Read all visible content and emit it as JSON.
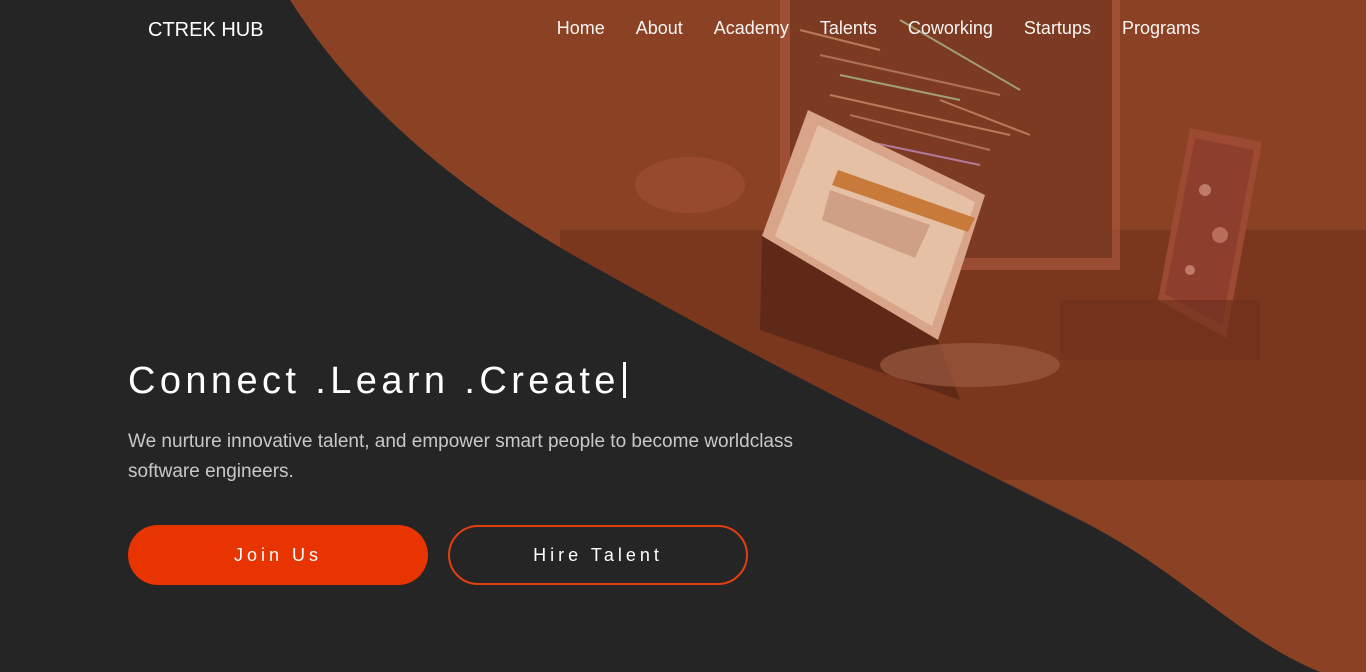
{
  "brand": {
    "name": "CTREK HUB"
  },
  "nav": {
    "items": [
      {
        "label": "Home"
      },
      {
        "label": "About"
      },
      {
        "label": "Academy"
      },
      {
        "label": "Talents"
      },
      {
        "label": "Coworking"
      },
      {
        "label": "Startups"
      },
      {
        "label": "Programs"
      }
    ]
  },
  "hero": {
    "headline": "Connect .Learn .Create",
    "subtitle": "We nurture innovative talent, and empower smart people to become worldclass software engineers.",
    "primary_button": "Join Us",
    "secondary_button": "Hire Talent"
  },
  "colors": {
    "background": "#252525",
    "accent": "#e83400",
    "hero_overlay": "#8a4124"
  },
  "icons": {
    "hero_image": "workstation-monitors-image"
  }
}
